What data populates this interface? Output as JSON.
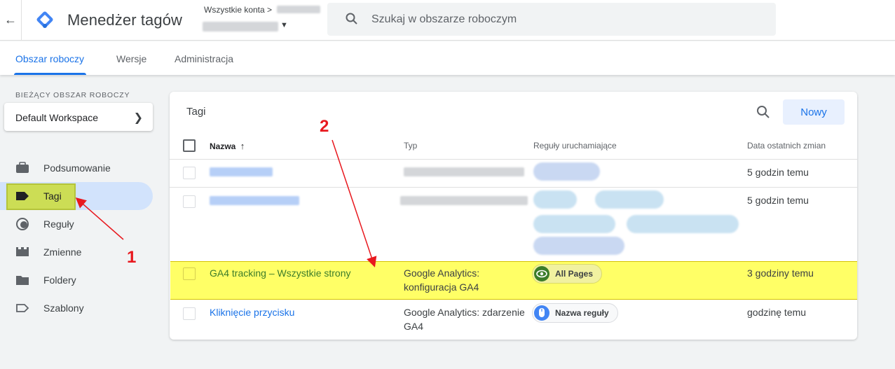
{
  "header": {
    "back_icon": "arrow-back-icon",
    "app_title": "Menedżer tagów",
    "account_label": "Wszystkie konta >",
    "search_placeholder": "Szukaj w obszarze roboczym"
  },
  "tabs": [
    {
      "label": "Obszar roboczy",
      "active": true
    },
    {
      "label": "Wersje",
      "active": false
    },
    {
      "label": "Administracja",
      "active": false
    }
  ],
  "sidebar": {
    "workspace_label": "BIEŻĄCY OBSZAR ROBOCZY",
    "workspace_name": "Default Workspace",
    "items": [
      {
        "label": "Podsumowanie",
        "icon": "briefcase-icon"
      },
      {
        "label": "Tagi",
        "icon": "tag-icon",
        "active": true
      },
      {
        "label": "Reguły",
        "icon": "trigger-icon"
      },
      {
        "label": "Zmienne",
        "icon": "variables-icon"
      },
      {
        "label": "Foldery",
        "icon": "folder-icon"
      },
      {
        "label": "Szablony",
        "icon": "template-icon"
      }
    ]
  },
  "tags_panel": {
    "title": "Tagi",
    "new_button": "Nowy",
    "columns": {
      "name": "Nazwa",
      "type": "Typ",
      "triggers": "Reguły uruchamiające",
      "modified": "Data ostatnich zmian"
    },
    "rows": [
      {
        "modified": "5 godzin temu"
      },
      {
        "modified": "5 godzin temu"
      },
      {
        "name": "GA4 tracking – Wszystkie strony",
        "type_line1": "Google Analytics:",
        "type_line2": "konfiguracja GA4",
        "trigger": "All Pages",
        "modified": "3 godziny temu"
      },
      {
        "name": "Kliknięcie przycisku",
        "type_line1": "Google Analytics: zdarzenie",
        "type_line2": "GA4",
        "trigger": "Nazwa reguły",
        "modified": "godzinę temu"
      }
    ]
  },
  "annotations": [
    "1",
    "2"
  ],
  "colors": {
    "accent": "#1a73e8",
    "highlight_yellow": "#ffff66",
    "annotation_red": "#e8181e"
  }
}
